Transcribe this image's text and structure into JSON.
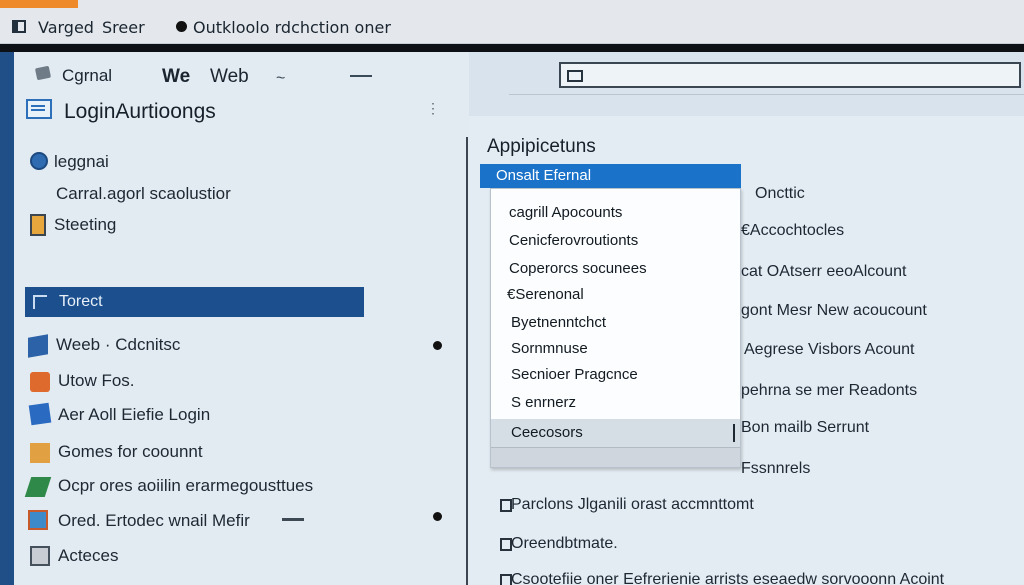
{
  "titlebar": {
    "app_name": "Varged",
    "store": "Sreer",
    "document": "Outkloolo rdchction oner"
  },
  "left": {
    "toolbar": {
      "gmail": "Cgrnal",
      "we": "We",
      "web": "Web",
      "wavy": "~"
    },
    "login_title": "LoginAurtioongs",
    "menu_dots": "⋮",
    "items": {
      "legal": "leggnai",
      "central": "Carral.agorl scaolustior",
      "setting": "Steeting"
    },
    "selected": "Torect",
    "list": {
      "wee": "Weeb · Cdcnitsc",
      "utow": "Utow Fos.",
      "aer": "Aer Aoll Eiefie Login",
      "gomes": "Gomes for coounnt",
      "ocpr": "Ocpr ores aoiilin erarmegousttues",
      "ored": "Ored. Ertodec wnail Mefir",
      "acces": "Acteces"
    }
  },
  "right": {
    "title": "Appipicetuns",
    "rows": {
      "r1": "Oncttic",
      "r2": "€Accochtocles",
      "r3": "cat OAtserr eeoAlcount",
      "r4": "gont Mesr New acoucount",
      "r5": "Aegrese Visbors Acount",
      "r6": "pehrna se mer Readonts",
      "r7": "Bon mailb Serrunt",
      "r8": "Fssnnrels",
      "r9": "Parclons Jlganili orast accmnttomt",
      "r10": "Oreendbtmate.",
      "r11": "Csootefiie oner Eefrerienie arrists eseaedw sorvooonn Acoint"
    }
  },
  "dropdown": {
    "header": "Onsalt Efernal",
    "items": [
      "cagrill Apocounts",
      "Cenicferovroutionts",
      "Coperorcs socunees",
      "€Serenonal",
      "Byetnenntchct",
      "Sornmnuse",
      "Secnioer Pragcnce",
      "S enrnerz",
      "Ceecosors"
    ]
  }
}
